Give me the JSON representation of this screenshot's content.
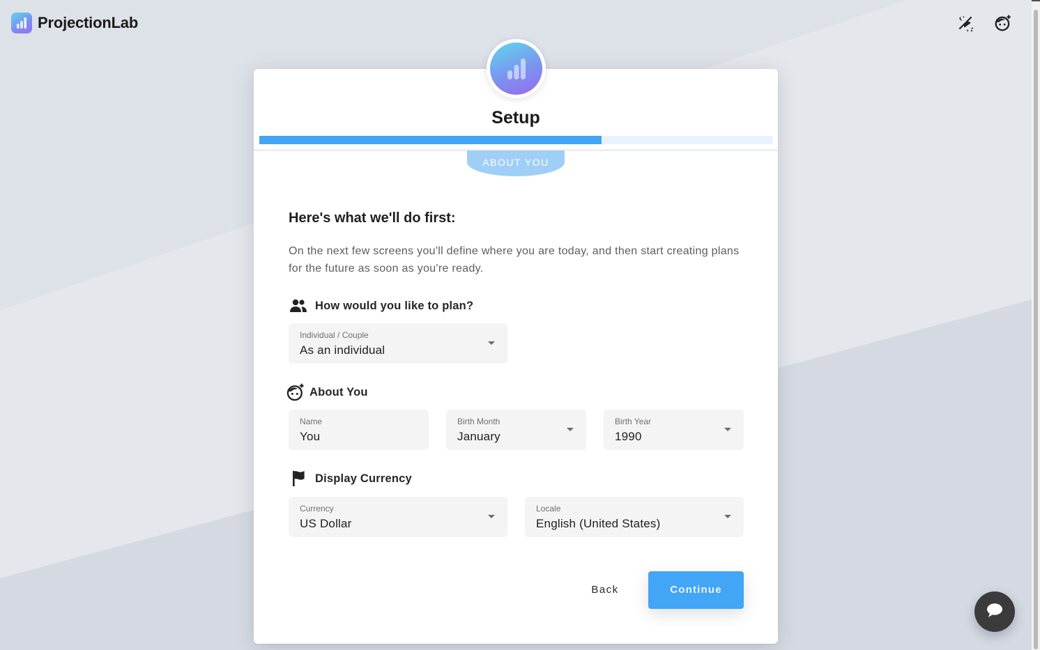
{
  "app": {
    "brand_name": "ProjectionLab",
    "brand_icon": "bar-chart-logo",
    "header_icons": [
      "theme-toggle-icon",
      "add-profile-face-icon"
    ]
  },
  "setup": {
    "title": "Setup",
    "progress_fraction": 0.667,
    "step_label": "ABOUT YOU",
    "accent_color": "#42a5f5"
  },
  "intro": {
    "heading": "Here's what we'll do first:",
    "text": "On the next few screens you'll define where you are today, and then start creating plans for the future as soon as you're ready."
  },
  "sections": {
    "plan": {
      "title": "How would you like to plan?",
      "icon": "people-icon",
      "field": {
        "label": "Individual / Couple",
        "value": "As an individual"
      }
    },
    "about": {
      "title": "About You",
      "icon": "face-sparkle-icon",
      "fields": [
        {
          "label": "Name",
          "value": "You"
        },
        {
          "label": "Birth Month",
          "value": "January"
        },
        {
          "label": "Birth Year",
          "value": "1990"
        }
      ]
    },
    "currency": {
      "title": "Display Currency",
      "icon": "flag-icon",
      "fields": [
        {
          "label": "Currency",
          "value": "US Dollar"
        },
        {
          "label": "Locale",
          "value": "English (United States)"
        }
      ]
    }
  },
  "actions": {
    "back_label": "Back",
    "continue_label": "Continue"
  },
  "chat": {
    "icon": "chat-bubble-icon"
  }
}
